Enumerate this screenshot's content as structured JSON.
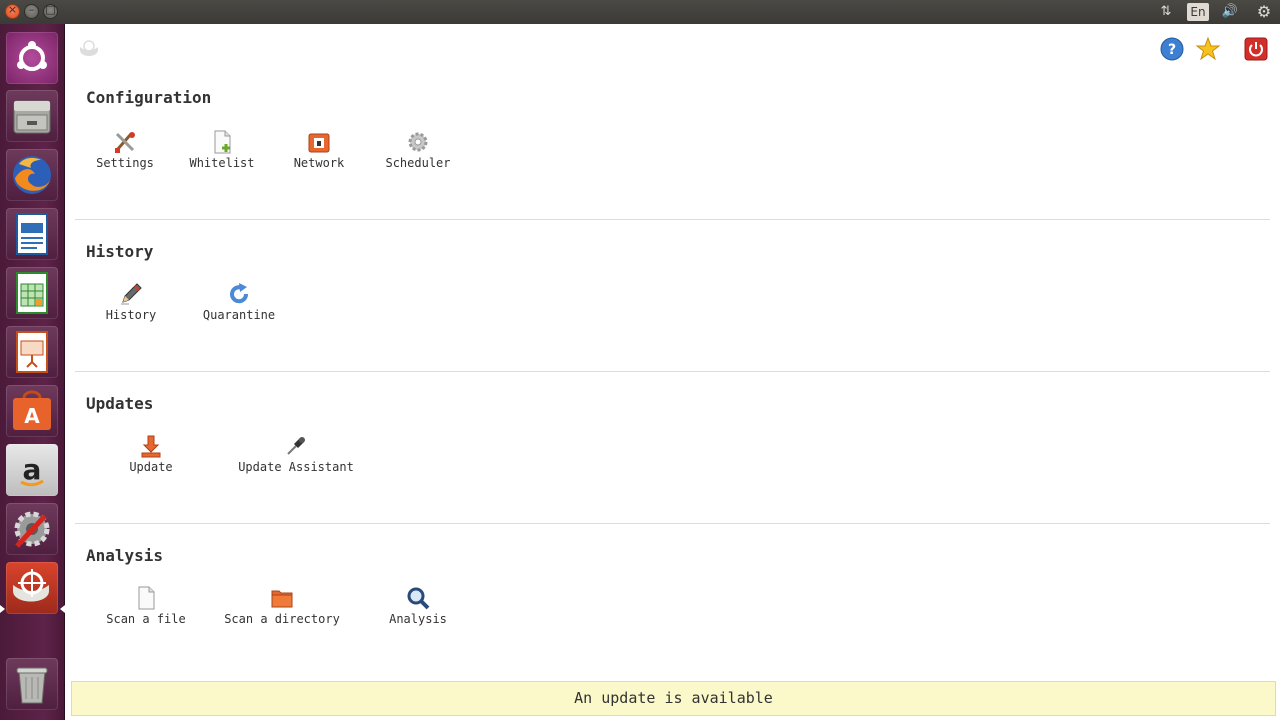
{
  "top_panel": {
    "close_glyph": "×",
    "minimize_glyph": "–",
    "maximize_glyph": "□",
    "keyboard_layout": "En",
    "network_glyph": "⇅",
    "sound_glyph": "🔊",
    "system_glyph": "⚙"
  },
  "launcher": {
    "items": [
      {
        "name": "ubuntu-dash-icon"
      },
      {
        "name": "file-manager-icon"
      },
      {
        "name": "firefox-icon"
      },
      {
        "name": "writer-icon"
      },
      {
        "name": "calc-icon"
      },
      {
        "name": "impress-icon"
      },
      {
        "name": "software-center-icon"
      },
      {
        "name": "amazon-icon"
      },
      {
        "name": "system-settings-icon"
      },
      {
        "name": "antivirus-app-icon"
      },
      {
        "name": "trash-icon"
      }
    ]
  },
  "header_icons": {
    "help": "help-icon",
    "favorite": "star-icon",
    "quit": "power-icon"
  },
  "sections": {
    "configuration": {
      "title": "Configuration",
      "items": [
        {
          "label": "Settings",
          "icon": "tools-icon"
        },
        {
          "label": "Whitelist",
          "icon": "whitelist-icon"
        },
        {
          "label": "Network",
          "icon": "network-icon"
        },
        {
          "label": "Scheduler",
          "icon": "scheduler-gear-icon"
        }
      ]
    },
    "history": {
      "title": "History",
      "items": [
        {
          "label": "History",
          "icon": "pencil-icon"
        },
        {
          "label": "Quarantine",
          "icon": "refresh-icon"
        }
      ]
    },
    "updates": {
      "title": "Updates",
      "items": [
        {
          "label": "Update",
          "icon": "download-icon"
        },
        {
          "label": "Update Assistant",
          "icon": "pipette-icon"
        }
      ]
    },
    "analysis": {
      "title": "Analysis",
      "items": [
        {
          "label": "Scan a file",
          "icon": "file-icon"
        },
        {
          "label": "Scan a directory",
          "icon": "folder-icon"
        },
        {
          "label": "Analysis",
          "icon": "magnifier-icon"
        }
      ]
    }
  },
  "status_bar": {
    "message": "An update is available",
    "background": "#fbf9c9"
  },
  "colors": {
    "launcher": "#5e2349",
    "panel": "#3b3a36",
    "close_button": "#de4b1f"
  }
}
